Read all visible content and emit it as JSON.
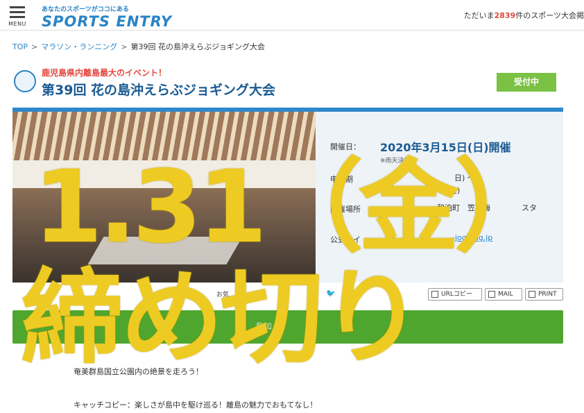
{
  "header": {
    "menu_label": "MENU",
    "logo_tagline": "あなたのスポーツがココにある",
    "logo_name": "SPORTS ENTRY",
    "count_prefix": "ただいま",
    "count_number": "2839",
    "count_suffix": "件のスポーツ大会掲"
  },
  "breadcrumb": {
    "home": "TOP",
    "category": "マラソン・ランニング",
    "current": "第39回 花の島沖えらぶジョギング大会"
  },
  "event": {
    "subtitle": "鹿児島県内離島最大のイベント！",
    "title": "第39回 花の島沖えらぶジョギング大会",
    "status": "受付中",
    "date_label": "開催日：",
    "date_value": "2020年3月15日(日)開催",
    "date_note": "※雨天決行",
    "period_label": "申込期",
    "period_value_1": "日) 〜",
    "period_value_2": "金)",
    "venue_label": "開催場所",
    "venue_value": "和泊町　笠石海",
    "venue_value_2": "スタ",
    "site_label": "公式サイ",
    "site_value": "-jogging.jp"
  },
  "share": {
    "favorite": "お気",
    "url_copy": "URLコピー",
    "mail": "MAIL",
    "print": "PRINT"
  },
  "entry_button": {
    "label": "参加"
  },
  "description": {
    "line1": "奄美群島国立公園内の絶景を走ろう！",
    "line2": "キャッチコピー：楽しさが島中を駆け巡る！離島の魅力でおもてなし！"
  },
  "overlay": {
    "line1": "1.31（金）",
    "line2": "締め切り"
  },
  "colors": {
    "brand_blue": "#2a84c6",
    "status_green": "#7bc143",
    "entry_green": "#4fa62e",
    "overlay_yellow": "#eecb22",
    "count_red": "#e4473e"
  }
}
